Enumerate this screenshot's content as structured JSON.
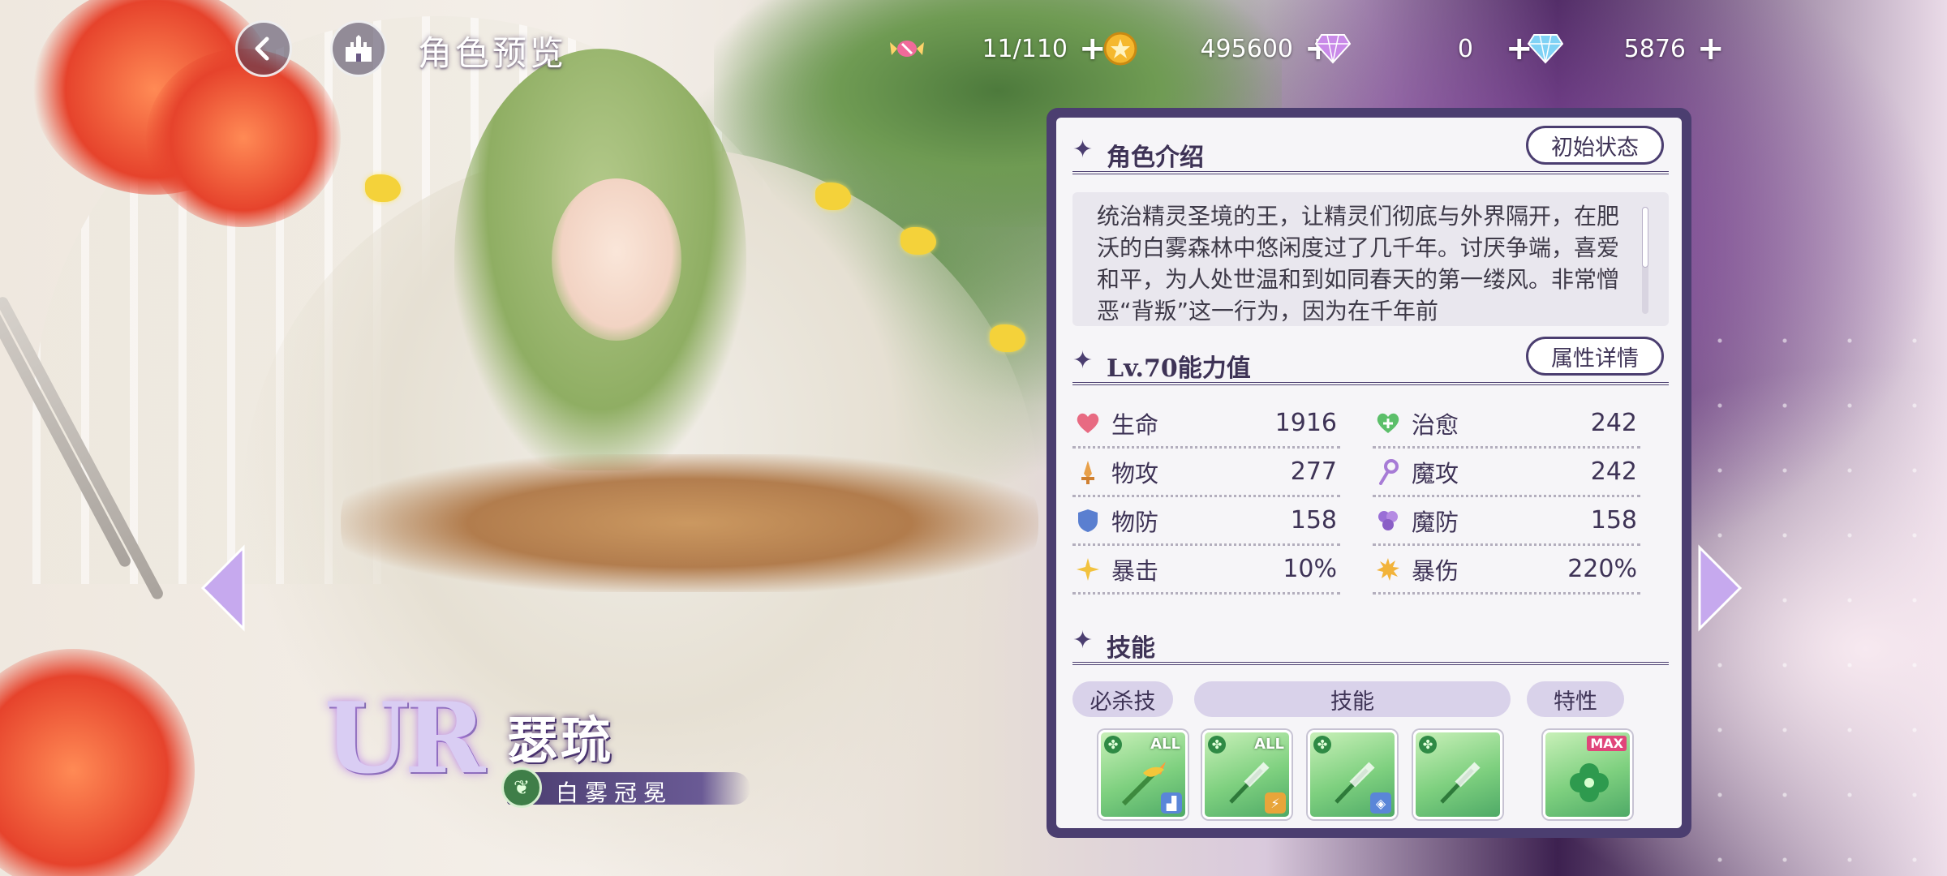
{
  "header": {
    "title": "角色预览",
    "resources": [
      {
        "icon": "candy-stamina-icon",
        "value": "11/110"
      },
      {
        "icon": "gold-coin-icon",
        "value": "495600"
      },
      {
        "icon": "purple-gem-icon",
        "value": "0"
      },
      {
        "icon": "blue-diamond-icon",
        "value": "5876"
      }
    ],
    "plus_label": "+"
  },
  "intro": {
    "section_title": "角色介绍",
    "button_label": "初始状态",
    "text": "统治精灵圣境的王，让精灵们彻底与外界隔开，在肥沃的白雾森林中悠闲度过了几千年。讨厌争端，喜爱和平，为人处世温和到如同春天的第一缕风。非常憎恶“背叛”这一行为，因为在千年前"
  },
  "stats": {
    "section_title": "Lv.70能力值",
    "button_label": "属性详情",
    "items": [
      {
        "name": "生命",
        "value": "1916",
        "icon": "heart-icon",
        "color": "#e86a82"
      },
      {
        "name": "治愈",
        "value": "242",
        "icon": "heal-heart-icon",
        "color": "#5cbf6a"
      },
      {
        "name": "物攻",
        "value": "277",
        "icon": "sword-icon",
        "color": "#e8a04a"
      },
      {
        "name": "魔攻",
        "value": "242",
        "icon": "wand-icon",
        "color": "#a77bd6"
      },
      {
        "name": "物防",
        "value": "158",
        "icon": "shield-icon",
        "color": "#5a7fd0"
      },
      {
        "name": "魔防",
        "value": "158",
        "icon": "magic-shield-icon",
        "color": "#9a6fd6"
      },
      {
        "name": "暴击",
        "value": "10%",
        "icon": "crit-star-icon",
        "color": "#f2c23e"
      },
      {
        "name": "暴伤",
        "value": "220%",
        "icon": "burst-icon",
        "color": "#f2b33a"
      }
    ]
  },
  "skills": {
    "section_title": "技能",
    "tabs": [
      "必杀技",
      "技能",
      "特性"
    ],
    "cards": [
      {
        "name": "ultimate-skill-card",
        "top_badge": "ALL",
        "corner_color": "#5a86d8"
      },
      {
        "name": "skill-card-1",
        "top_badge": "ALL",
        "corner_color": "#e8a53a"
      },
      {
        "name": "skill-card-2",
        "top_badge": "",
        "corner_color": "#5a86d8"
      },
      {
        "name": "skill-card-3",
        "top_badge": "",
        "corner_color": ""
      },
      {
        "name": "trait-card",
        "top_badge": "MAX",
        "corner_color": ""
      }
    ]
  },
  "character": {
    "rarity": "UR",
    "name": "瑟琉",
    "title": "白雾冠冕",
    "element": "wind"
  },
  "colors": {
    "panel_frame": "#4b3e70",
    "panel_bg": "#f6f5f8",
    "tab_bg": "#d9d2ea",
    "skill_green": "#7ed07f"
  }
}
